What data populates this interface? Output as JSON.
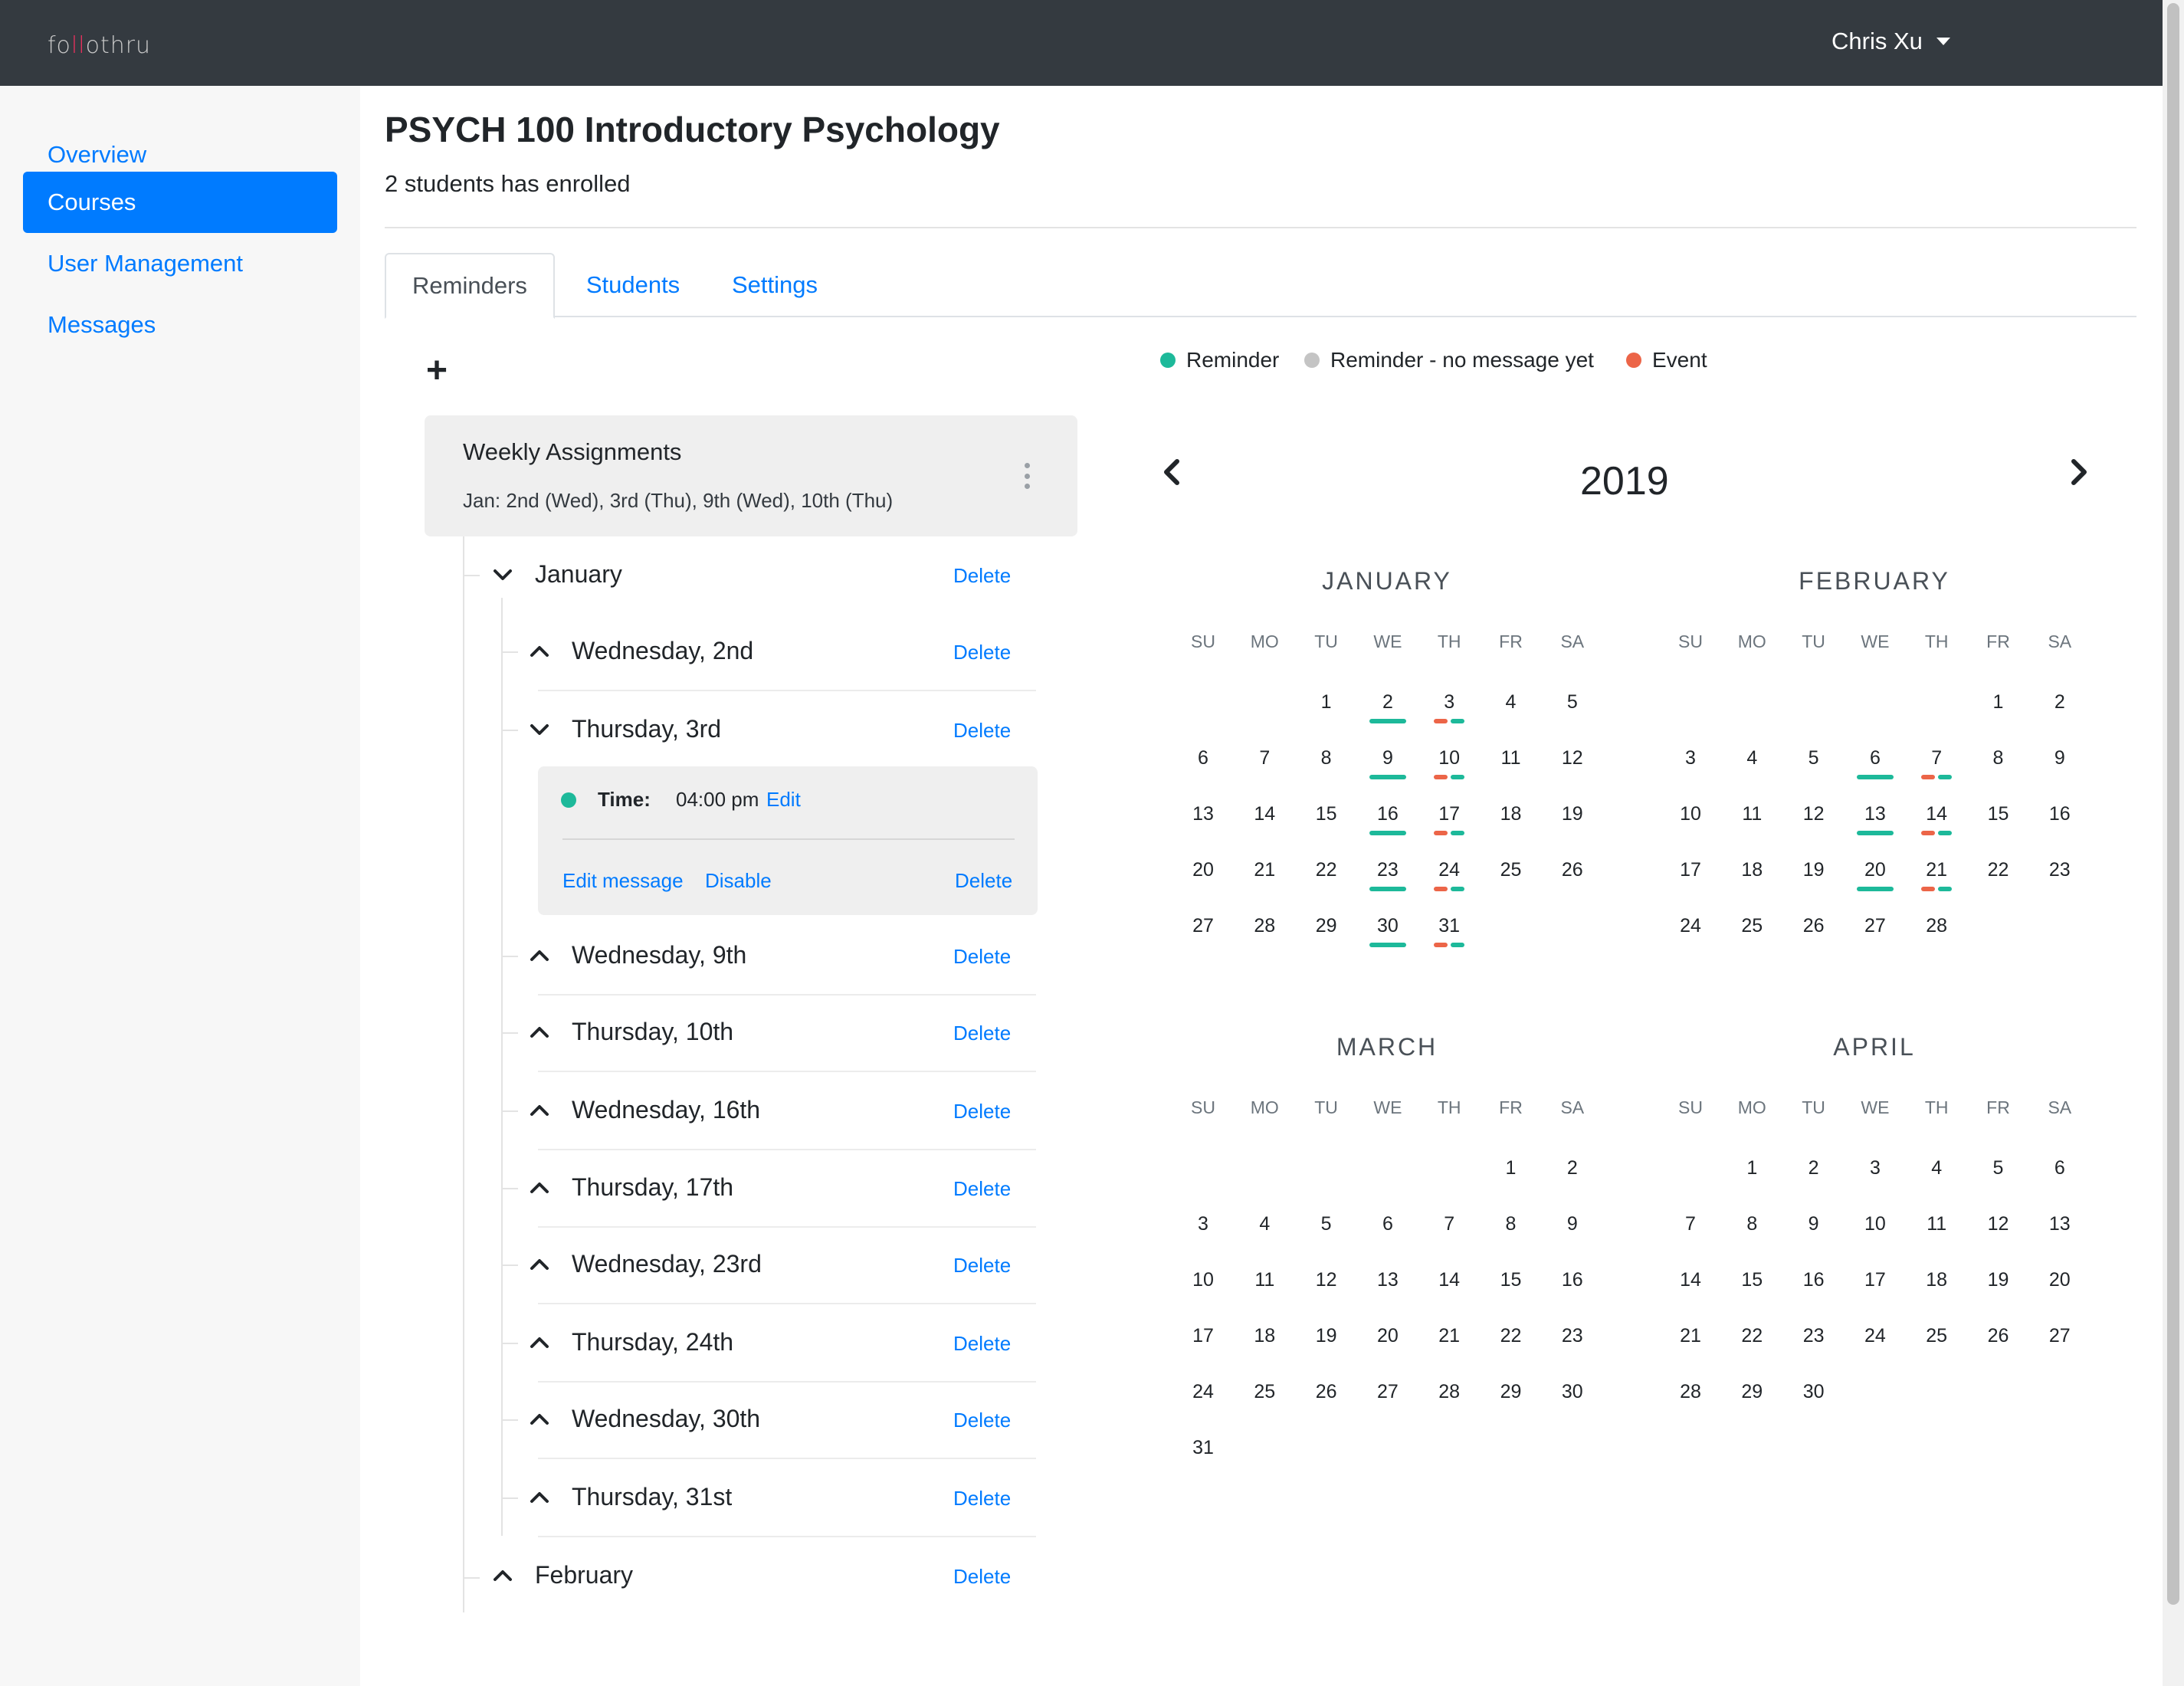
{
  "topbar": {
    "logo_pre": "fo",
    "logo_dot": "ll",
    "logo_post": "othru",
    "user_name": "Chris Xu"
  },
  "sidebar": {
    "items": [
      {
        "label": "Overview"
      },
      {
        "label": "Courses"
      },
      {
        "label": "User Management"
      },
      {
        "label": "Messages"
      }
    ]
  },
  "page": {
    "title": "PSYCH 100 Introductory Psychology",
    "subtitle": "2 students has enrolled"
  },
  "tabs": [
    {
      "label": "Reminders"
    },
    {
      "label": "Students"
    },
    {
      "label": "Settings"
    }
  ],
  "add_icon": "plus-icon",
  "reminder": {
    "title": "Weekly Assignments",
    "dates": "Jan: 2nd (Wed), 3rd (Thu), 9th (Wed), 10th (Thu)"
  },
  "tree": {
    "delete_label": "Delete",
    "january": "January",
    "february": "February",
    "days": [
      "Wednesday, 2nd",
      "Thursday, 3rd",
      "Wednesday, 9th",
      "Thursday, 10th",
      "Wednesday, 16th",
      "Thursday, 17th",
      "Wednesday, 23rd",
      "Thursday, 24th",
      "Wednesday, 30th",
      "Thursday, 31st"
    ],
    "detail": {
      "time_label": "Time:",
      "time_value": "04:00 pm",
      "edit": "Edit",
      "edit_message": "Edit message",
      "disable": "Disable",
      "delete": "Delete"
    }
  },
  "legend": [
    {
      "label": "Reminder",
      "color": "#1db99a"
    },
    {
      "label": "Reminder - no message yet",
      "color": "#c4c4c4"
    },
    {
      "label": "Event",
      "color": "#ec6548"
    }
  ],
  "calendar": {
    "year": "2019",
    "weekdays": [
      "SU",
      "MO",
      "TU",
      "WE",
      "TH",
      "FR",
      "SA"
    ],
    "months": [
      {
        "name": "JANUARY",
        "start": 2,
        "days": 31,
        "reminders": [
          2,
          3,
          9,
          10,
          16,
          17,
          23,
          24,
          30,
          31
        ],
        "events": [
          3,
          10,
          17,
          24,
          31
        ]
      },
      {
        "name": "FEBRUARY",
        "start": 5,
        "days": 28,
        "reminders": [
          6,
          7,
          13,
          14,
          20,
          21
        ],
        "events": [
          7,
          14,
          21
        ]
      },
      {
        "name": "MARCH",
        "start": 5,
        "days": 31,
        "reminders": [],
        "events": []
      },
      {
        "name": "APRIL",
        "start": 1,
        "days": 30,
        "reminders": [],
        "events": []
      }
    ],
    "colors": {
      "reminder": "#1db99a",
      "event": "#ec6548"
    }
  }
}
